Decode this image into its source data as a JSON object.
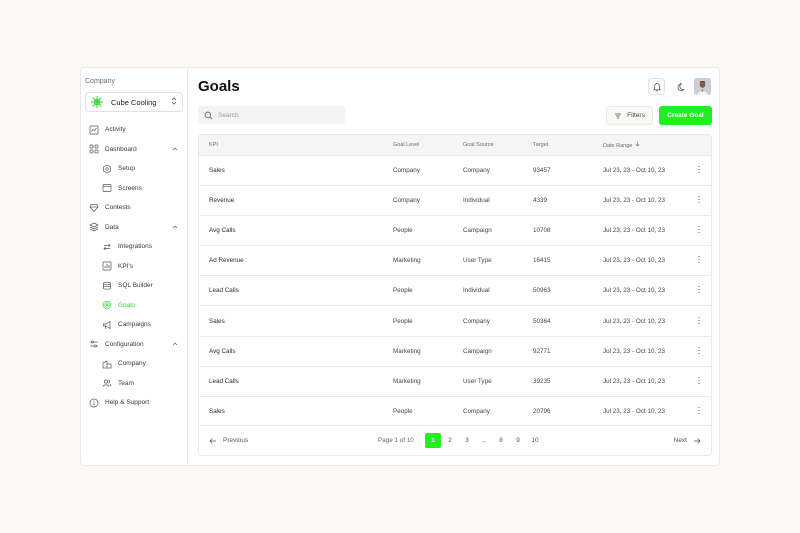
{
  "sidebar": {
    "company_label": "Company",
    "company_name": "Cube Cooling",
    "items": [
      {
        "label": "Activity",
        "icon": "activity-icon",
        "sub": false
      },
      {
        "label": "Dashboard",
        "icon": "dashboard-icon",
        "sub": false,
        "expanded": true
      },
      {
        "label": "Setup",
        "icon": "setup-icon",
        "sub": true
      },
      {
        "label": "Screens",
        "icon": "screens-icon",
        "sub": true
      },
      {
        "label": "Contests",
        "icon": "trophy-icon",
        "sub": false
      },
      {
        "label": "Data",
        "icon": "layers-icon",
        "sub": false,
        "expanded": true
      },
      {
        "label": "Integrations",
        "icon": "arrows-icon",
        "sub": true
      },
      {
        "label": "KPI's",
        "icon": "chart-icon",
        "sub": true
      },
      {
        "label": "SQL Builder",
        "icon": "database-icon",
        "sub": true
      },
      {
        "label": "Goals",
        "icon": "target-icon",
        "sub": true,
        "active": true
      },
      {
        "label": "Campaigns",
        "icon": "megaphone-icon",
        "sub": true
      },
      {
        "label": "Configuration",
        "icon": "sliders-icon",
        "sub": false,
        "expanded": true
      },
      {
        "label": "Company",
        "icon": "building-icon",
        "sub": true
      },
      {
        "label": "Team",
        "icon": "team-icon",
        "sub": true
      },
      {
        "label": "Help & Support",
        "icon": "help-icon",
        "sub": false
      }
    ]
  },
  "header": {
    "title": "Goals"
  },
  "toolbar": {
    "search_placeholder": "Search",
    "filters_label": "Filters",
    "create_label": "Create Goal"
  },
  "table": {
    "columns": [
      "KPI",
      "Goal Level",
      "Goal Source",
      "Target",
      "Date Range"
    ],
    "sort_column": "Date Range",
    "rows": [
      [
        "Sales",
        "Company",
        "Company",
        "93457",
        "Jul 23, 23 - Oct 10, 23"
      ],
      [
        "Revenue",
        "Company",
        "Individual",
        "4339",
        "Jul 23, 23 - Oct 10, 23"
      ],
      [
        "Avg Calls",
        "People",
        "Campaign",
        "10708",
        "Jul 23, 23 - Oct 10, 23"
      ],
      [
        "Ad Revenue",
        "Marketing",
        "User Type",
        "16415",
        "Jul 23, 23 - Oct 10, 23"
      ],
      [
        "Lead Calls",
        "People",
        "Individual",
        "50963",
        "Jul 23, 23 - Oct 10, 23"
      ],
      [
        "Sales",
        "People",
        "Company",
        "50364",
        "Jul 23, 23 - Oct 10, 23"
      ],
      [
        "Avg Calls",
        "Marketing",
        "Campaign",
        "92771",
        "Jul 23, 23 - Oct 10, 23"
      ],
      [
        "Lead Calls",
        "Marketing",
        "User Type",
        "39235",
        "Jul 23, 23 - Oct 10, 23"
      ],
      [
        "Sales",
        "People",
        "Company",
        "20796",
        "Jul 23, 23 - Oct 10, 23"
      ]
    ]
  },
  "pagination": {
    "previous_label": "Previous",
    "next_label": "Next",
    "page_of": "Page 1 of 10",
    "pages": [
      "1",
      "2",
      "3",
      "...",
      "8",
      "9",
      "10"
    ],
    "current": "1"
  },
  "colors": {
    "accent": "#22ee22",
    "active_text": "#2fd52f",
    "background": "#fcf8f4"
  }
}
